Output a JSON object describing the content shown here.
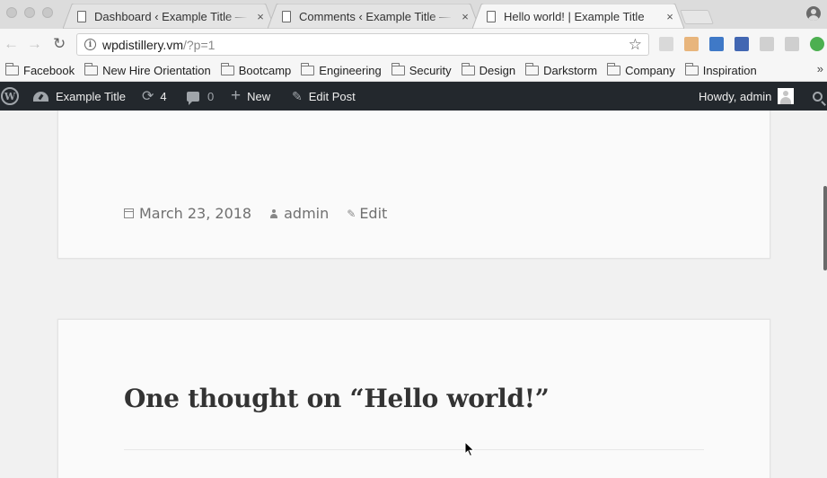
{
  "browser": {
    "tabs": [
      {
        "title": "Dashboard ‹ Example Title — WordPress",
        "active": false
      },
      {
        "title": "Comments ‹ Example Title — WordPress",
        "active": false
      },
      {
        "title": "Hello world! | Example Title",
        "active": true
      }
    ],
    "close_glyph": "×",
    "url_host": "wpdistillery.vm",
    "url_path": "/?p=1",
    "info_glyph": "i",
    "star_glyph": "☆",
    "back_glyph": "←",
    "forward_glyph": "→",
    "reload_glyph": "↻",
    "extensions": [
      {
        "icon": "extension-1-icon",
        "color": "#d9d9d9"
      },
      {
        "icon": "extension-2-icon",
        "color": "#e8b57c"
      },
      {
        "icon": "bookmark-ext-icon",
        "color": "#3f79c7"
      },
      {
        "icon": "facebook-ext-icon",
        "color": "#4267b2"
      },
      {
        "icon": "facebook-ext-2-icon",
        "color": "#d0d0d0"
      },
      {
        "icon": "f-ext-icon",
        "color": "#cfcfcf"
      },
      {
        "icon": "upload-ext-icon",
        "color": "#4caf50"
      }
    ]
  },
  "bookmarks": {
    "items": [
      "Facebook",
      "New Hire Orientation",
      "Bootcamp",
      "Engineering",
      "Security",
      "Design",
      "Darkstorm",
      "Company",
      "Inspiration"
    ],
    "more_glyph": "»"
  },
  "adminbar": {
    "wp_logo": "W",
    "site_name": "Example Title",
    "updates_count": "4",
    "updates_glyph": "⟳",
    "comments_count": "0",
    "new_label": "New",
    "new_glyph": "+",
    "edit_post_label": "Edit Post",
    "edit_glyph": "✎",
    "howdy": "Howdy, admin",
    "accent": "#23282d"
  },
  "post": {
    "date": "March 23, 2018",
    "author": "admin",
    "edit_label": "Edit",
    "edit_glyph": "✎"
  },
  "comments": {
    "title": "One thought on “Hello world!”"
  }
}
